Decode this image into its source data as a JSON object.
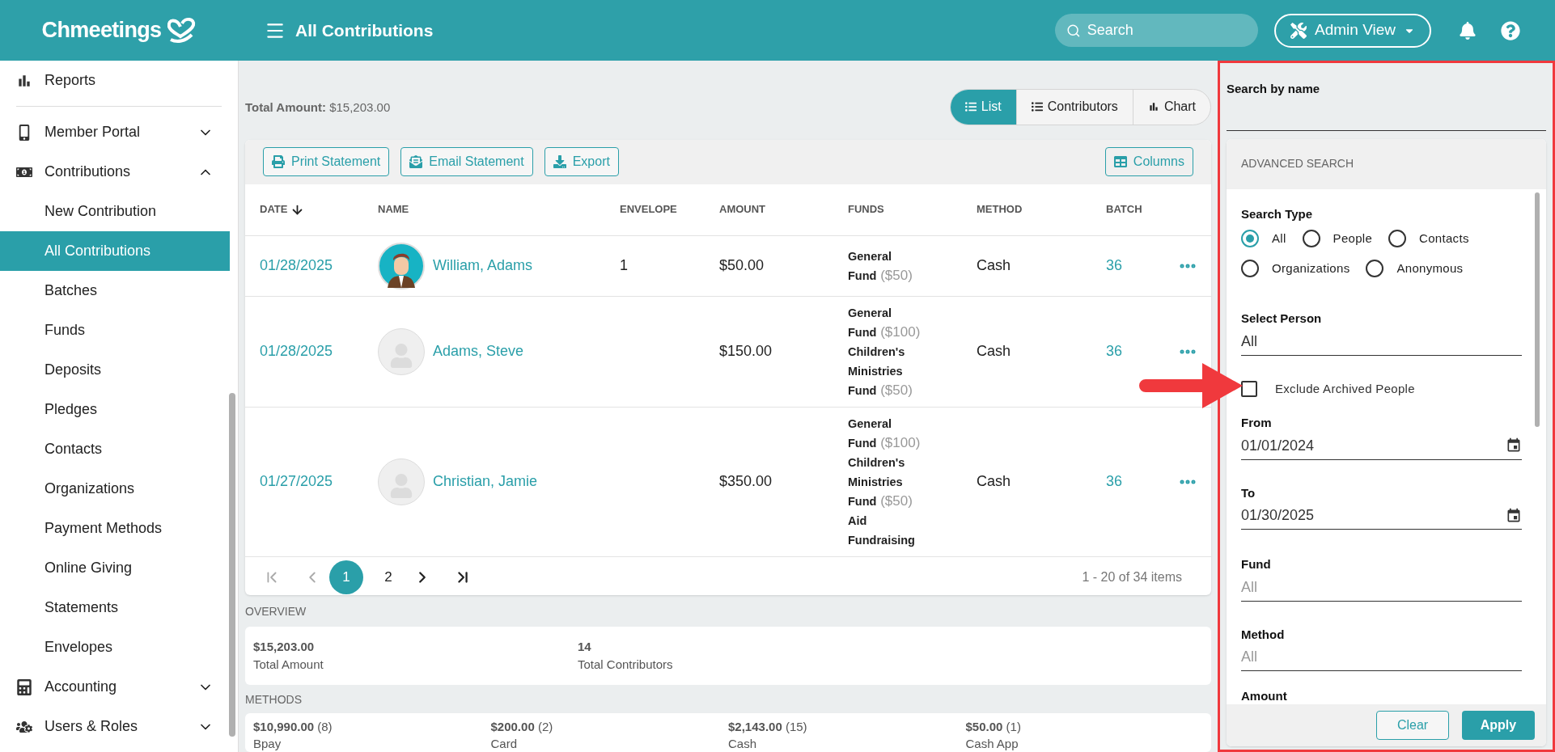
{
  "header": {
    "logo": "Chmeetings",
    "page_title": "All Contributions",
    "search": {
      "placeholder": "Search"
    },
    "admin_view": "Admin View"
  },
  "sidebar": {
    "items": [
      {
        "label": "Reports",
        "selected": false
      },
      {
        "label": "Member Portal",
        "selected": false,
        "expanded": false
      },
      {
        "label": "Contributions",
        "selected": false,
        "expanded": true,
        "children": [
          {
            "label": "New Contribution",
            "selected": false
          },
          {
            "label": "All Contributions",
            "selected": true
          },
          {
            "label": "Batches",
            "selected": false
          },
          {
            "label": "Funds",
            "selected": false
          },
          {
            "label": "Deposits",
            "selected": false
          },
          {
            "label": "Pledges",
            "selected": false
          },
          {
            "label": "Contacts",
            "selected": false
          },
          {
            "label": "Organizations",
            "selected": false
          },
          {
            "label": "Payment Methods",
            "selected": false
          },
          {
            "label": "Online Giving",
            "selected": false
          },
          {
            "label": "Statements",
            "selected": false
          },
          {
            "label": "Envelopes",
            "selected": false
          }
        ]
      },
      {
        "label": "Accounting",
        "selected": false,
        "expanded": false
      },
      {
        "label": "Users & Roles",
        "selected": false,
        "expanded": false
      }
    ]
  },
  "main": {
    "total_amount": {
      "label": "Total Amount:",
      "value": "$15,203.00"
    },
    "view_tabs": [
      {
        "label": "List",
        "selected": true
      },
      {
        "label": "Contributors",
        "selected": false
      },
      {
        "label": "Chart",
        "selected": false
      }
    ],
    "toolbar": {
      "buttons": [
        "Print Statement",
        "Email Statement",
        "Export"
      ],
      "columns_button": "Columns"
    },
    "table": {
      "columns": [
        {
          "label": "DATE",
          "sorted": true
        },
        {
          "label": "NAME",
          "sorted": false
        },
        {
          "label": "ENVELOPE",
          "sorted": false
        },
        {
          "label": "AMOUNT",
          "sorted": false
        },
        {
          "label": "FUNDS",
          "sorted": false
        },
        {
          "label": "METHOD",
          "sorted": false
        },
        {
          "label": "BATCH",
          "sorted": false
        }
      ],
      "rows": [
        {
          "date": "01/28/2025",
          "name": "William, Adams",
          "has_picture": true,
          "envelope": "1",
          "amount": "$50.00",
          "funds": [
            {
              "name": "General Fund",
              "amount": "($50)"
            }
          ],
          "method": "Cash",
          "batch": "36"
        },
        {
          "date": "01/28/2025",
          "name": "Adams, Steve",
          "has_picture": false,
          "envelope": "",
          "amount": "$150.00",
          "funds": [
            {
              "name": "General Fund",
              "amount": "($100)"
            },
            {
              "name": "Children's Ministries Fund",
              "amount": "($50)"
            }
          ],
          "method": "Cash",
          "batch": "36"
        },
        {
          "date": "01/27/2025",
          "name": "Christian, Jamie",
          "has_picture": false,
          "envelope": "",
          "amount": "$350.00",
          "funds": [
            {
              "name": "General Fund",
              "amount": "($100)"
            },
            {
              "name": "Children's Ministries Fund",
              "amount": "($50)"
            },
            {
              "name": "Aid Fundraising"
            }
          ],
          "method": "Cash",
          "batch": "36"
        }
      ]
    },
    "pagination": {
      "pages": [
        {
          "label": "1",
          "selected": true
        },
        {
          "label": "2",
          "selected": false
        }
      ],
      "summary": "1 - 20 of 34 items"
    },
    "overview": {
      "title": "OVERVIEW",
      "stats": [
        {
          "value": "$15,203.00",
          "label": "Total Amount"
        },
        {
          "value": "14",
          "label": "Total Contributors"
        }
      ]
    },
    "methods": {
      "title": "METHODS",
      "items": [
        {
          "amount": "$10,990.00",
          "count": "(8)",
          "label": "Bpay"
        },
        {
          "amount": "$200.00",
          "count": "(2)",
          "label": "Card"
        },
        {
          "amount": "$2,143.00",
          "count": "(15)",
          "label": "Cash"
        },
        {
          "amount": "$50.00",
          "count": "(1)",
          "label": "Cash App"
        }
      ]
    }
  },
  "filter_panel": {
    "search_by_name": {
      "label": "Search by name"
    },
    "advanced": {
      "title": "ADVANCED SEARCH",
      "search_type": {
        "label": "Search Type",
        "options": [
          {
            "label": "All",
            "selected": true
          },
          {
            "label": "People",
            "selected": false
          },
          {
            "label": "Contacts",
            "selected": false
          },
          {
            "label": "Organizations",
            "selected": false
          },
          {
            "label": "Anonymous",
            "selected": false
          }
        ]
      },
      "select_person": {
        "label": "Select Person",
        "value": "All"
      },
      "exclude_archived": {
        "label": "Exclude Archived People",
        "checked": false
      },
      "from": {
        "label": "From",
        "value": "01/01/2024"
      },
      "to": {
        "label": "To",
        "value": "01/30/2025"
      },
      "fund": {
        "label": "Fund",
        "placeholder": "All"
      },
      "method": {
        "label": "Method",
        "placeholder": "All"
      },
      "amount": {
        "label": "Amount"
      }
    },
    "buttons": {
      "clear": "Clear",
      "apply": "Apply"
    }
  }
}
